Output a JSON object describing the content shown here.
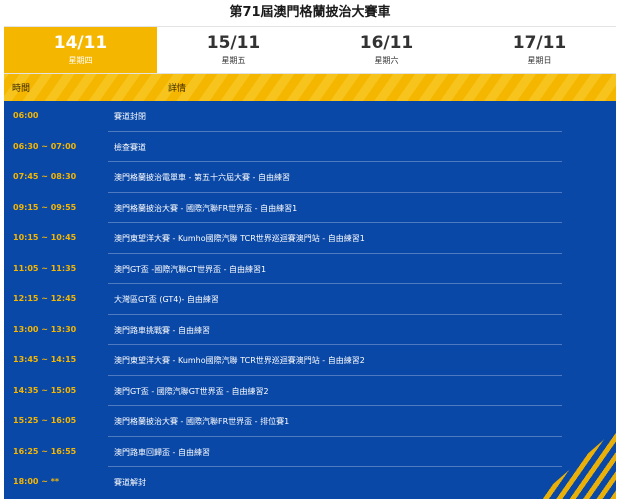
{
  "page": {
    "title": "第71屆澳門格蘭披治大賽車"
  },
  "tabs": [
    {
      "date": "14/11",
      "day": "星期四",
      "active": true
    },
    {
      "date": "15/11",
      "day": "星期五",
      "active": false
    },
    {
      "date": "16/11",
      "day": "星期六",
      "active": false
    },
    {
      "date": "17/11",
      "day": "星期日",
      "active": false
    }
  ],
  "schedule": {
    "header": {
      "time": "時間",
      "detail": "詳情"
    },
    "rows": [
      {
        "time": "06:00",
        "desc": "賽道封閉"
      },
      {
        "time": "06:30 ~ 07:00",
        "desc": "檢查賽道"
      },
      {
        "time": "07:45 ~ 08:30",
        "desc": "澳門格蘭披治電單車 - 第五十六屆大賽 - 自由練習"
      },
      {
        "time": "09:15 ~ 09:55",
        "desc": "澳門格蘭披治大賽 - 國際汽聯FR世界盃 - 自由練習1"
      },
      {
        "time": "10:15 ~ 10:45",
        "desc": "澳門東望洋大賽 - Kumho國際汽聯 TCR世界巡迴賽澳門站 - 自由練習1"
      },
      {
        "time": "11:05 ~ 11:35",
        "desc": "澳門GT盃 -國際汽聯GT世界盃 - 自由練習1"
      },
      {
        "time": "12:15 ~ 12:45",
        "desc": "大灣區GT盃 (GT4)- 自由練習"
      },
      {
        "time": "13:00 ~ 13:30",
        "desc": "澳門路車挑戰賽 - 自由練習"
      },
      {
        "time": "13:45 ~ 14:15",
        "desc": "澳門東望洋大賽 - Kumho國際汽聯 TCR世界巡迴賽澳門站 - 自由練習2"
      },
      {
        "time": "14:35 ~ 15:05",
        "desc": "澳門GT盃 - 國際汽聯GT世界盃 - 自由練習2"
      },
      {
        "time": "15:25 ~ 16:05",
        "desc": "澳門格蘭披治大賽 - 國際汽聯FR世界盃 - 排位賽1"
      },
      {
        "time": "16:25 ~ 16:55",
        "desc": "澳門路車回歸盃 - 自由練習"
      },
      {
        "time": "18:00 ~ **",
        "desc": "賽道解封"
      }
    ]
  },
  "colors": {
    "accent": "#f5b600",
    "panel": "#0a48a7",
    "text_on_panel": "#ffffff"
  }
}
